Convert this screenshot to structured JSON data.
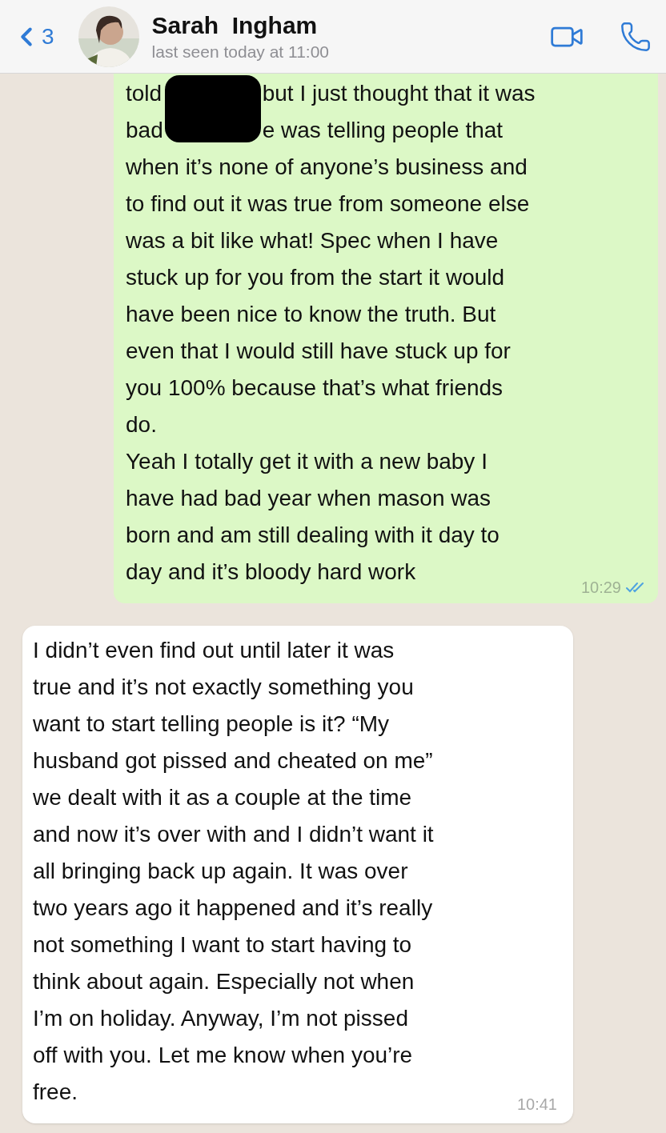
{
  "header": {
    "back_count": "3",
    "contact_name": "Sarah  Ingham",
    "last_seen": "last seen today at 11:00"
  },
  "messages": [
    {
      "kind": "outgoing",
      "redacted_lines": [
        {
          "before": "told",
          "after": "but I just thought that it was"
        },
        {
          "before": "bad",
          "after": "e was telling people that"
        }
      ],
      "lines": [
        "when it’s none of anyone’s business and",
        "to find out it was true from someone else",
        "was a bit like what! Spec when I have",
        "stuck up for you from the start it would",
        "have been nice to know the truth. But",
        "even that I would still have stuck up for",
        "you 100% because that’s what friends",
        "do.",
        "Yeah I totally get it with a new baby I",
        "have had bad year when mason was",
        "born and am still dealing with it day to",
        "day and it’s bloody hard work"
      ],
      "time": "10:29",
      "read": true
    },
    {
      "kind": "incoming",
      "lines": [
        "I didn’t even find out until later it was",
        "true and it’s not exactly something you",
        "want to start telling people is it? “My",
        "husband got pissed and cheated on me”",
        "we dealt with it as a couple at the time",
        "and now it’s over with and I didn’t want it",
        "all bringing back up again. It was over",
        "two years ago it happened and it’s really",
        "not something I want to start having to",
        "think about again. Especially not when",
        "I’m on holiday. Anyway, I’m not pissed",
        "off with you. Let me know when you’re",
        "free."
      ],
      "time": "10:41"
    }
  ]
}
